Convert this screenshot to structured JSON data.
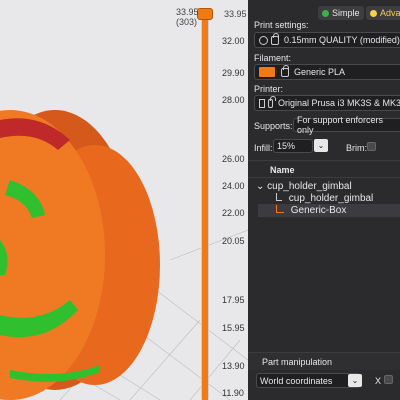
{
  "slider": {
    "top_value": "33.95",
    "top_layer": "(303)",
    "top_value_right": "33.95",
    "ticks": [
      "32.00",
      "29.90",
      "28.00",
      "26.00",
      "24.00",
      "22.00",
      "20.05",
      "17.95",
      "15.95",
      "13.90",
      "11.90"
    ]
  },
  "mode": {
    "simple": "Simple",
    "advanced": "Adva"
  },
  "print_settings": {
    "label": "Print settings:",
    "value": "0.15mm QUALITY (modified)"
  },
  "filament": {
    "label": "Filament:",
    "value": "Generic PLA",
    "color": "#f07a14"
  },
  "printer": {
    "label": "Printer:",
    "value": "Original Prusa i3 MK3S & MK3"
  },
  "supports": {
    "label": "Supports:",
    "value": "For support enforcers only"
  },
  "infill": {
    "label": "Infill:",
    "value": "15%"
  },
  "brim": {
    "label": "Brim:"
  },
  "object_list": {
    "header": "Name",
    "items": [
      {
        "label": "cup_holder_gimbal",
        "level": 0
      },
      {
        "label": "cup_holder_gimbal",
        "level": 1
      },
      {
        "label": "Generic-Box",
        "level": 1
      }
    ]
  },
  "part_manipulation": {
    "title": "Part manipulation",
    "coordinates": "World coordinates",
    "x_label": "X"
  }
}
